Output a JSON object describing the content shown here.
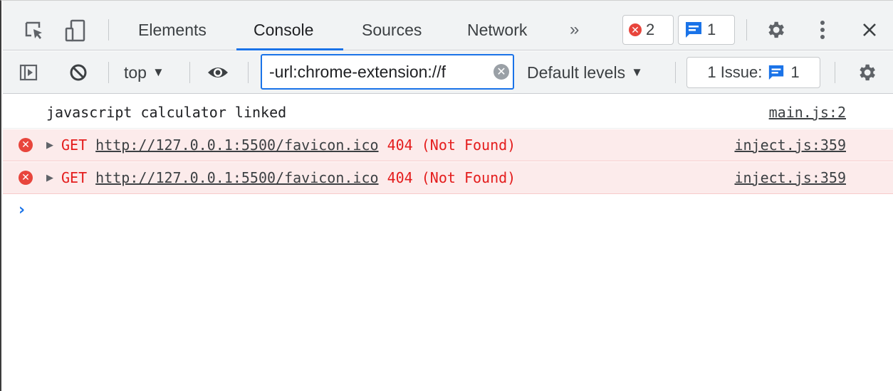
{
  "tabs": {
    "items": [
      {
        "label": "Elements"
      },
      {
        "label": "Console"
      },
      {
        "label": "Sources"
      },
      {
        "label": "Network"
      }
    ],
    "more": "»",
    "error_count": "2",
    "message_count": "1"
  },
  "toolbar": {
    "context": "top",
    "filter_value": "-url:chrome-extension://f",
    "levels": "Default levels",
    "issues_label": "1 Issue:",
    "issues_count": "1"
  },
  "console": {
    "log": {
      "text": "javascript calculator linked",
      "source": "main.js:2"
    },
    "errors": [
      {
        "method": "GET",
        "url": "http://127.0.0.1:5500/favicon.ico",
        "status": "404 (Not Found)",
        "source": "inject.js:359"
      },
      {
        "method": "GET",
        "url": "http://127.0.0.1:5500/favicon.ico",
        "status": "404 (Not Found)",
        "source": "inject.js:359"
      }
    ],
    "prompt": "›"
  },
  "colors": {
    "accent": "#1a73e8",
    "error": "#e41c1c",
    "error_bg": "#fcebeb",
    "toolbar_bg": "#f1f3f4"
  },
  "icons": [
    "inspect-element-icon",
    "device-toolbar-icon",
    "error-icon",
    "message-icon",
    "gear-icon",
    "kebab-menu-icon",
    "close-icon",
    "sidebar-toggle-icon",
    "clear-console-icon",
    "eye-icon",
    "clear-input-icon"
  ]
}
